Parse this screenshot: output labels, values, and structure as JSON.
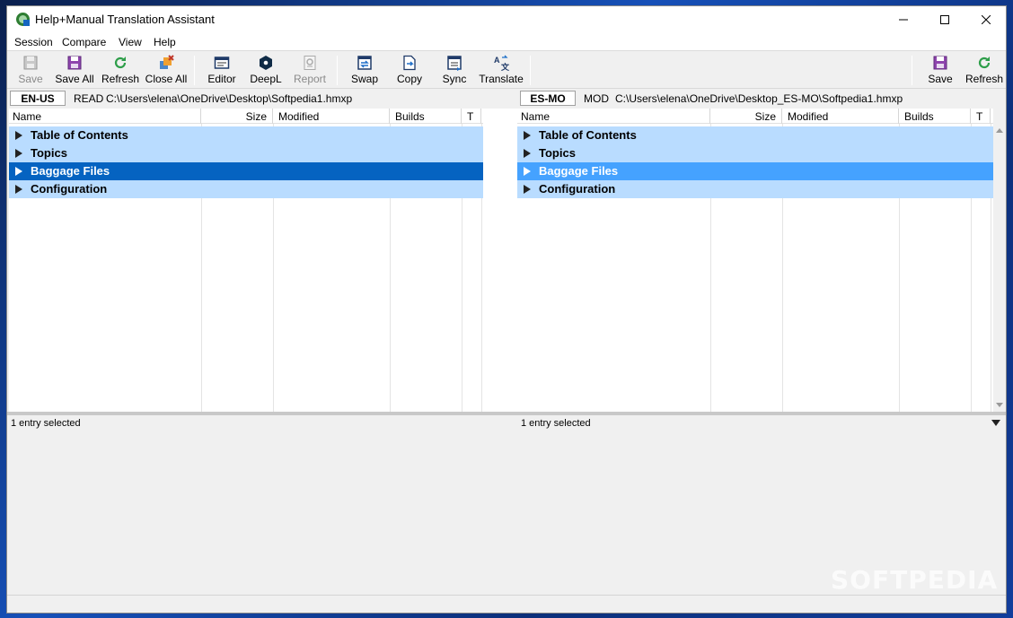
{
  "window": {
    "title": "Help+Manual Translation Assistant"
  },
  "menu": [
    "Session",
    "Compare",
    "View",
    "Help"
  ],
  "toolbar": {
    "save": "Save",
    "save_all": "Save All",
    "refresh": "Refresh",
    "close_all": "Close All",
    "editor": "Editor",
    "deepl": "DeepL",
    "report": "Report",
    "swap": "Swap",
    "copy": "Copy",
    "sync": "Sync",
    "translate": "Translate",
    "right_save": "Save",
    "right_refresh": "Refresh"
  },
  "left": {
    "lang": "EN-US",
    "mode": "READ",
    "path": "C:\\Users\\elena\\OneDrive\\Desktop\\Softpedia1.hmxp",
    "columns": [
      "Name",
      "Size",
      "Modified",
      "Builds",
      "T"
    ],
    "rows": [
      "Table of Contents",
      "Topics",
      "Baggage Files",
      "Configuration"
    ],
    "status": "1 entry selected"
  },
  "right": {
    "lang": "ES-MO",
    "mode": "MOD",
    "path": "C:\\Users\\elena\\OneDrive\\Desktop_ES-MO\\Softpedia1.hmxp",
    "columns": [
      "Name",
      "Size",
      "Modified",
      "Builds",
      "T"
    ],
    "rows": [
      "Table of Contents",
      "Topics",
      "Baggage Files",
      "Configuration"
    ],
    "status": "1 entry selected"
  },
  "watermark": "SOFTPEDIA",
  "colors": {
    "row_bg": "#b9dcff",
    "selected_left": "#0563c1",
    "selected_right": "#45a2ff"
  }
}
